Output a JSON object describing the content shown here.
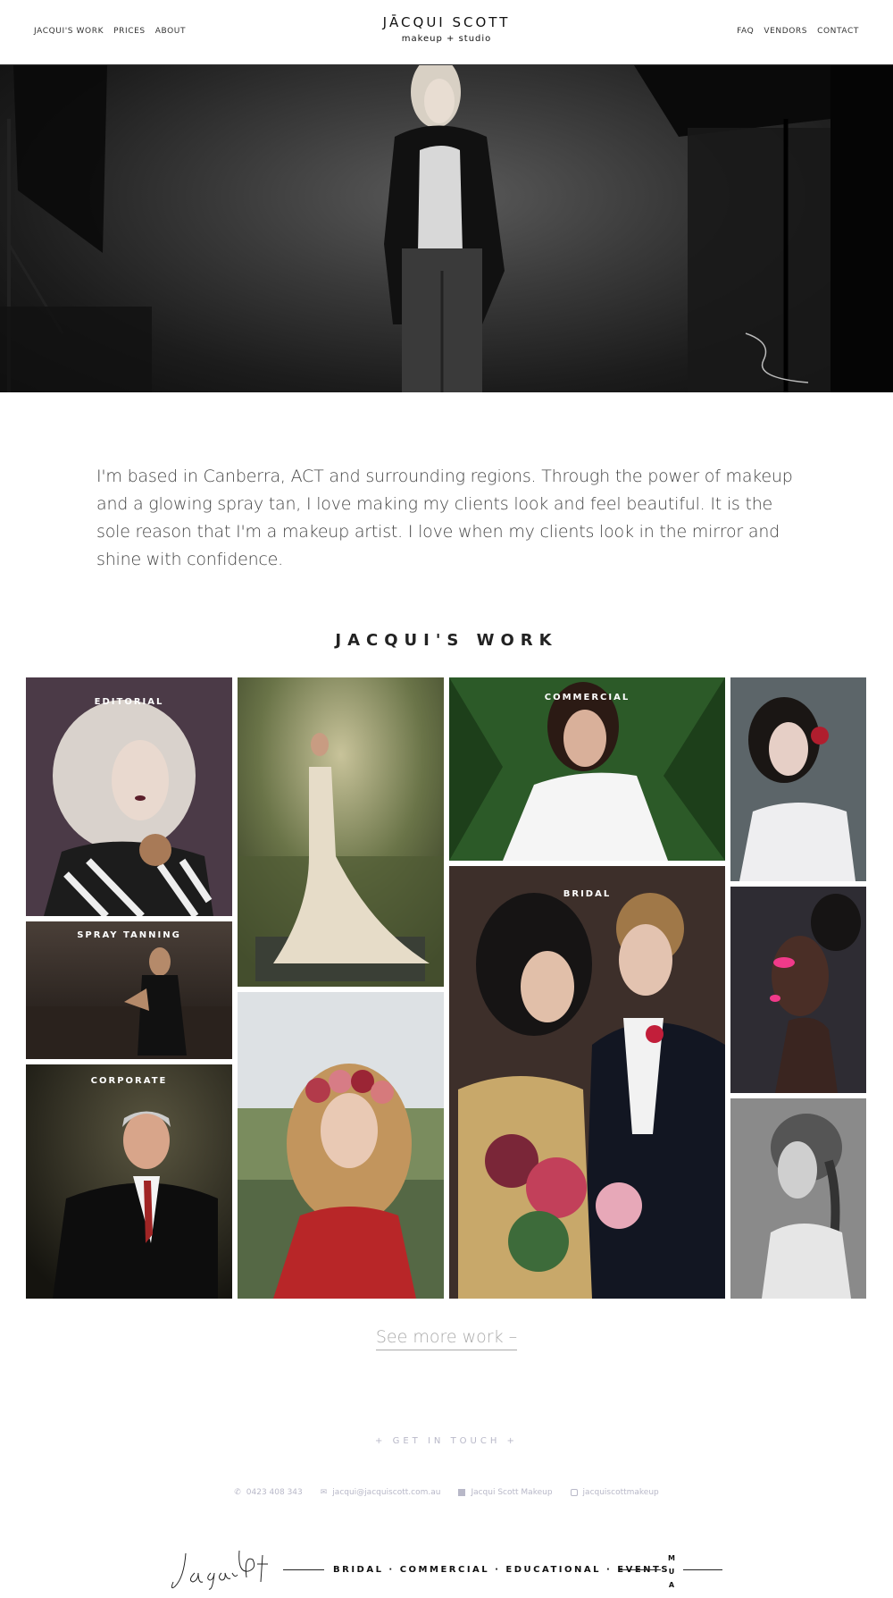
{
  "nav": {
    "left": [
      "JACQUI'S WORK",
      "PRICES",
      "ABOUT"
    ],
    "right": [
      "FAQ",
      "VENDORS",
      "CONTACT"
    ]
  },
  "brand": {
    "name": "JĀCQUI SCOTT",
    "sub": "makeup + studio"
  },
  "intro": "I'm based in Canberra, ACT and surrounding regions. Through the power of makeup and a glowing spray tan, I love making my clients look and feel beautiful. It is the sole reason that I'm a makeup artist. I love when my clients look in the mirror and shine with confidence.",
  "work": {
    "title": "JACQUI'S WORK",
    "labels": {
      "editorial": "EDITORIAL",
      "spray": "SPRAY TANNING",
      "corporate": "CORPORATE",
      "commercial": "COMMERCIAL",
      "bridal": "BRIDAL"
    },
    "see_more": "See more work –"
  },
  "contact": {
    "heading": "+ GET IN TOUCH +",
    "phone": "0423 408 343",
    "email": "jacqui@jacquiscott.com.au",
    "facebook": "Jacqui Scott Makeup",
    "instagram": "jacquiscottmakeup"
  },
  "footer": {
    "tagline": "BRIDAL · COMMERCIAL · EDUCATIONAL · EVENTS",
    "mua": [
      "M",
      "U",
      "A"
    ]
  },
  "colors": {
    "accent": "#b8b8c8",
    "text": "#222222"
  }
}
